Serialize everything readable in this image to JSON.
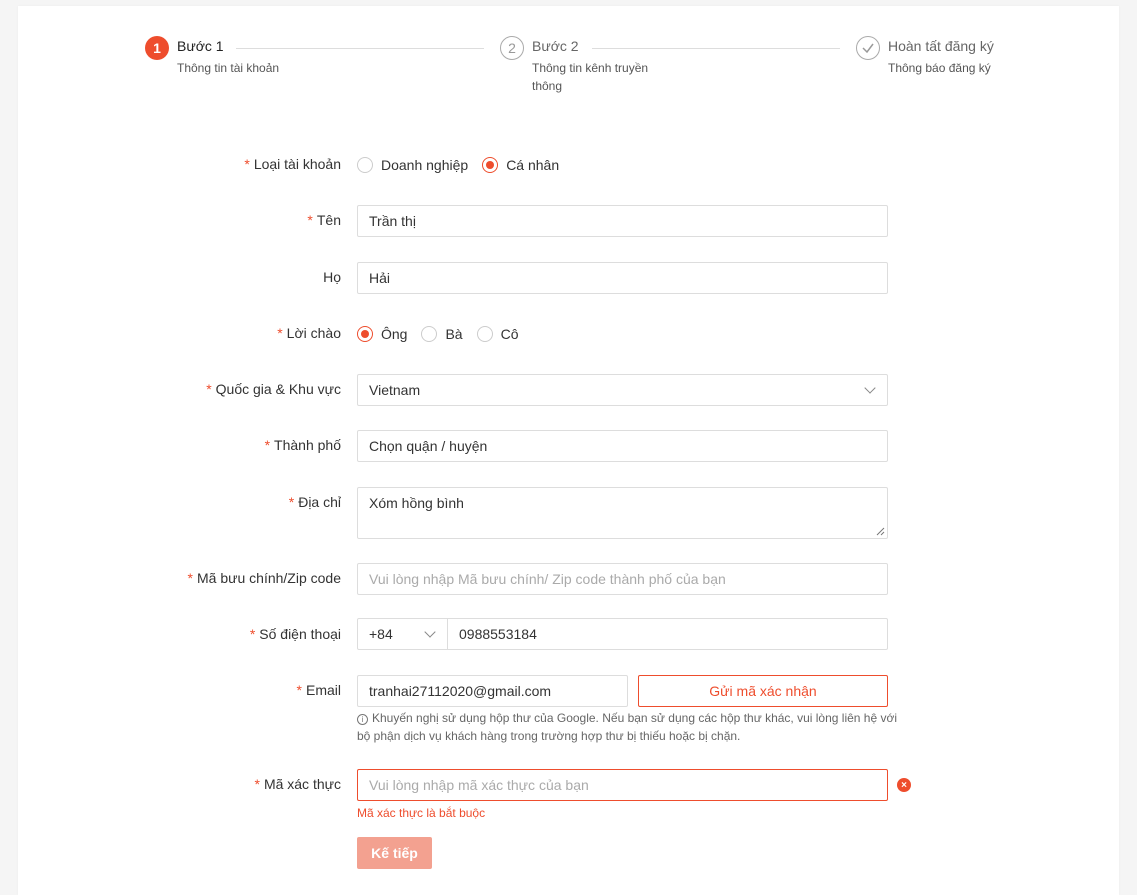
{
  "steps": [
    {
      "number": "1",
      "title": "Bước 1",
      "desc": "Thông tin tài khoản"
    },
    {
      "number": "2",
      "title": "Bước 2",
      "desc": "Thông tin kênh truyền thông"
    },
    {
      "title": "Hoàn tất đăng ký",
      "desc": "Thông báo đăng ký"
    }
  ],
  "form": {
    "required_mark": "*",
    "account_type": {
      "label": "Loại tài khoản",
      "options": [
        "Doanh nghiệp",
        "Cá nhân"
      ],
      "selected": "Cá nhân"
    },
    "first_name": {
      "label": "Tên",
      "value": "Trần thị"
    },
    "last_name": {
      "label": "Họ",
      "value": "Hải"
    },
    "salutation": {
      "label": "Lời chào",
      "options": [
        "Ông",
        "Bà",
        "Cô"
      ],
      "selected": "Ông"
    },
    "country": {
      "label": "Quốc gia & Khu vực",
      "value": "Vietnam"
    },
    "city": {
      "label": "Thành phố",
      "value": "Chọn quận / huyện"
    },
    "address": {
      "label": "Địa chỉ",
      "value": "Xóm hồng bình"
    },
    "zip": {
      "label": "Mã bưu chính/Zip code",
      "placeholder": "Vui lòng nhập Mã bưu chính/ Zip code thành phố của bạn"
    },
    "phone": {
      "label": "Số điện thoại",
      "code": "+84",
      "value": "0988553184"
    },
    "email": {
      "label": "Email",
      "value": "tranhai27112020@gmail.com",
      "send_code_label": "Gửi mã xác nhận",
      "hint": "Khuyến nghị sử dụng hộp thư của Google. Nếu bạn sử dụng các hộp thư khác, vui lòng liên hệ với bộ phận dịch vụ khách hàng trong trường hợp thư bị thiếu hoặc bị chặn."
    },
    "verification": {
      "label": "Mã xác thực",
      "placeholder": "Vui lòng nhập mã xác thực của bạn",
      "error": "Mã xác thực là bắt buộc"
    },
    "next_label": "Kế tiếp"
  },
  "colors": {
    "accent": "#ee4d2d",
    "disabled_button": "#f3a190"
  }
}
